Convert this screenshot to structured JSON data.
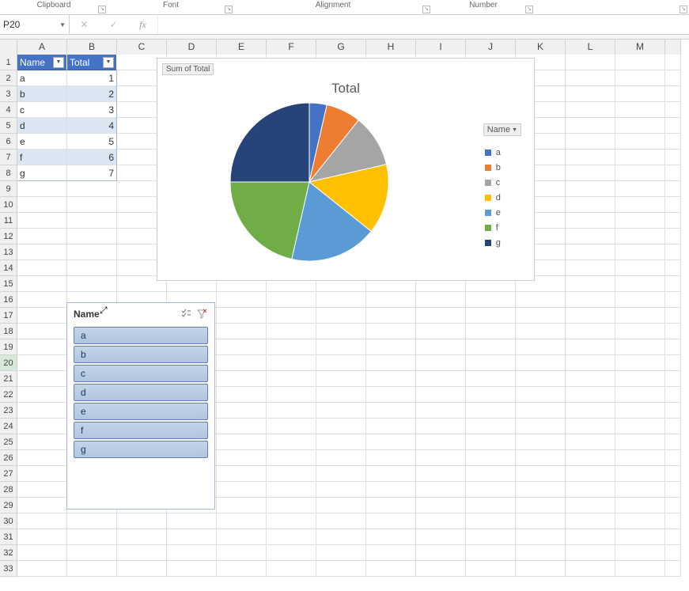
{
  "ribbon": {
    "groups": [
      "Clipboard",
      "Font",
      "Alignment",
      "Number"
    ]
  },
  "namebox": {
    "value": "P20"
  },
  "grid": {
    "columns": [
      "A",
      "B",
      "C",
      "D",
      "E",
      "F",
      "G",
      "H",
      "I",
      "J",
      "K",
      "L",
      "M"
    ],
    "row_count": 33,
    "selected_row": 20
  },
  "table": {
    "headers": [
      "Name",
      "Total"
    ],
    "rows": [
      {
        "name": "a",
        "total": 1
      },
      {
        "name": "b",
        "total": 2
      },
      {
        "name": "c",
        "total": 3
      },
      {
        "name": "d",
        "total": 4
      },
      {
        "name": "e",
        "total": 5
      },
      {
        "name": "f",
        "total": 6
      },
      {
        "name": "g",
        "total": 7
      }
    ]
  },
  "chart": {
    "sum_label": "Sum of Total",
    "title": "Total",
    "legend_field": "Name",
    "legend": [
      {
        "label": "a",
        "color": "#4472c4"
      },
      {
        "label": "b",
        "color": "#ed7d31"
      },
      {
        "label": "c",
        "color": "#a5a5a5"
      },
      {
        "label": "d",
        "color": "#ffc000"
      },
      {
        "label": "e",
        "color": "#5b9bd5"
      },
      {
        "label": "f",
        "color": "#70ad47"
      },
      {
        "label": "g",
        "color": "#264478"
      }
    ]
  },
  "chart_data": {
    "type": "pie",
    "title": "Total",
    "categories": [
      "a",
      "b",
      "c",
      "d",
      "e",
      "f",
      "g"
    ],
    "values": [
      1,
      2,
      3,
      4,
      5,
      6,
      7
    ],
    "colors": [
      "#4472c4",
      "#ed7d31",
      "#a5a5a5",
      "#ffc000",
      "#5b9bd5",
      "#70ad47",
      "#264478"
    ],
    "legend_position": "right"
  },
  "slicer": {
    "title": "Name",
    "items": [
      "a",
      "b",
      "c",
      "d",
      "e",
      "f",
      "g"
    ],
    "multi_select_icon": "multi-select-icon",
    "clear_filter_icon": "clear-filter-icon"
  }
}
